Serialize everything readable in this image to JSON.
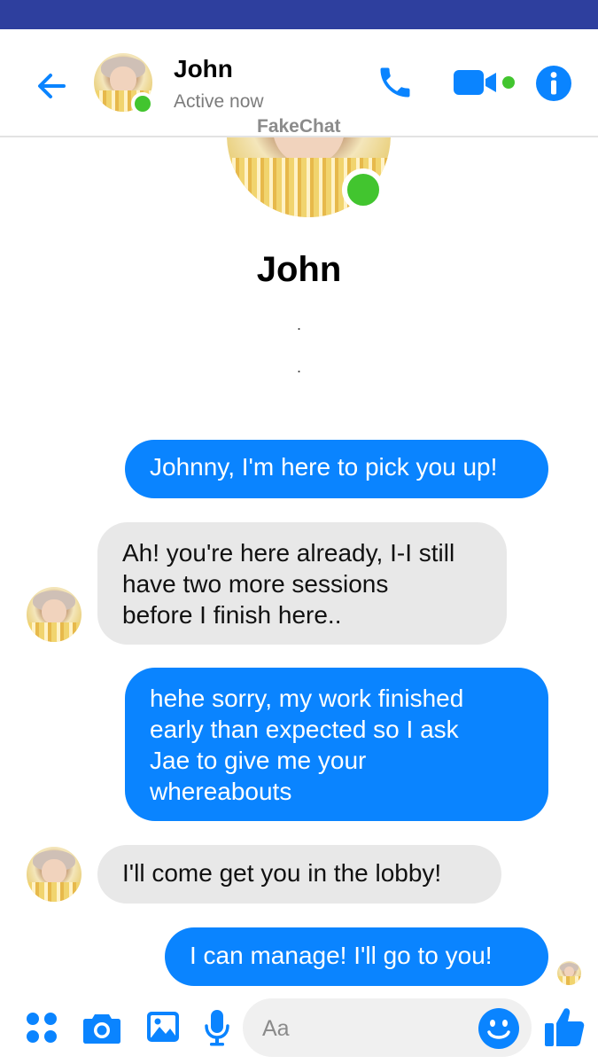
{
  "header": {
    "contact_name": "John",
    "contact_status": "Active now",
    "watermark": "FakeChat"
  },
  "profile": {
    "name": "John",
    "line1": ".",
    "line2": "."
  },
  "messages": [
    {
      "direction": "out",
      "text": "Johnny, I'm here to pick you up!"
    },
    {
      "direction": "in",
      "lines": [
        "Ah! you're here already, I-I still",
        "have two more sessions",
        "before I finish here.."
      ]
    },
    {
      "direction": "out",
      "lines": [
        "hehe sorry,  my work finished",
        "early than expected so I ask",
        "Jae to give me your",
        "whereabouts"
      ]
    },
    {
      "direction": "in",
      "text": "I'll come get you in the lobby!"
    },
    {
      "direction": "out",
      "text": "I can manage! I'll go to you!"
    }
  ],
  "composer": {
    "placeholder": "Aa"
  },
  "icons": {
    "back": "back-arrow-icon",
    "call": "phone-icon",
    "video": "video-camera-icon",
    "info": "info-icon",
    "apps": "apps-grid-icon",
    "camera": "camera-icon",
    "gallery": "image-icon",
    "mic": "microphone-icon",
    "emoji": "emoji-icon",
    "like": "thumbs-up-icon"
  },
  "colors": {
    "accent": "#0a84ff",
    "statusbar": "#2e3f9e",
    "incoming_bubble": "#e8e8e8",
    "online": "#42c52f"
  }
}
